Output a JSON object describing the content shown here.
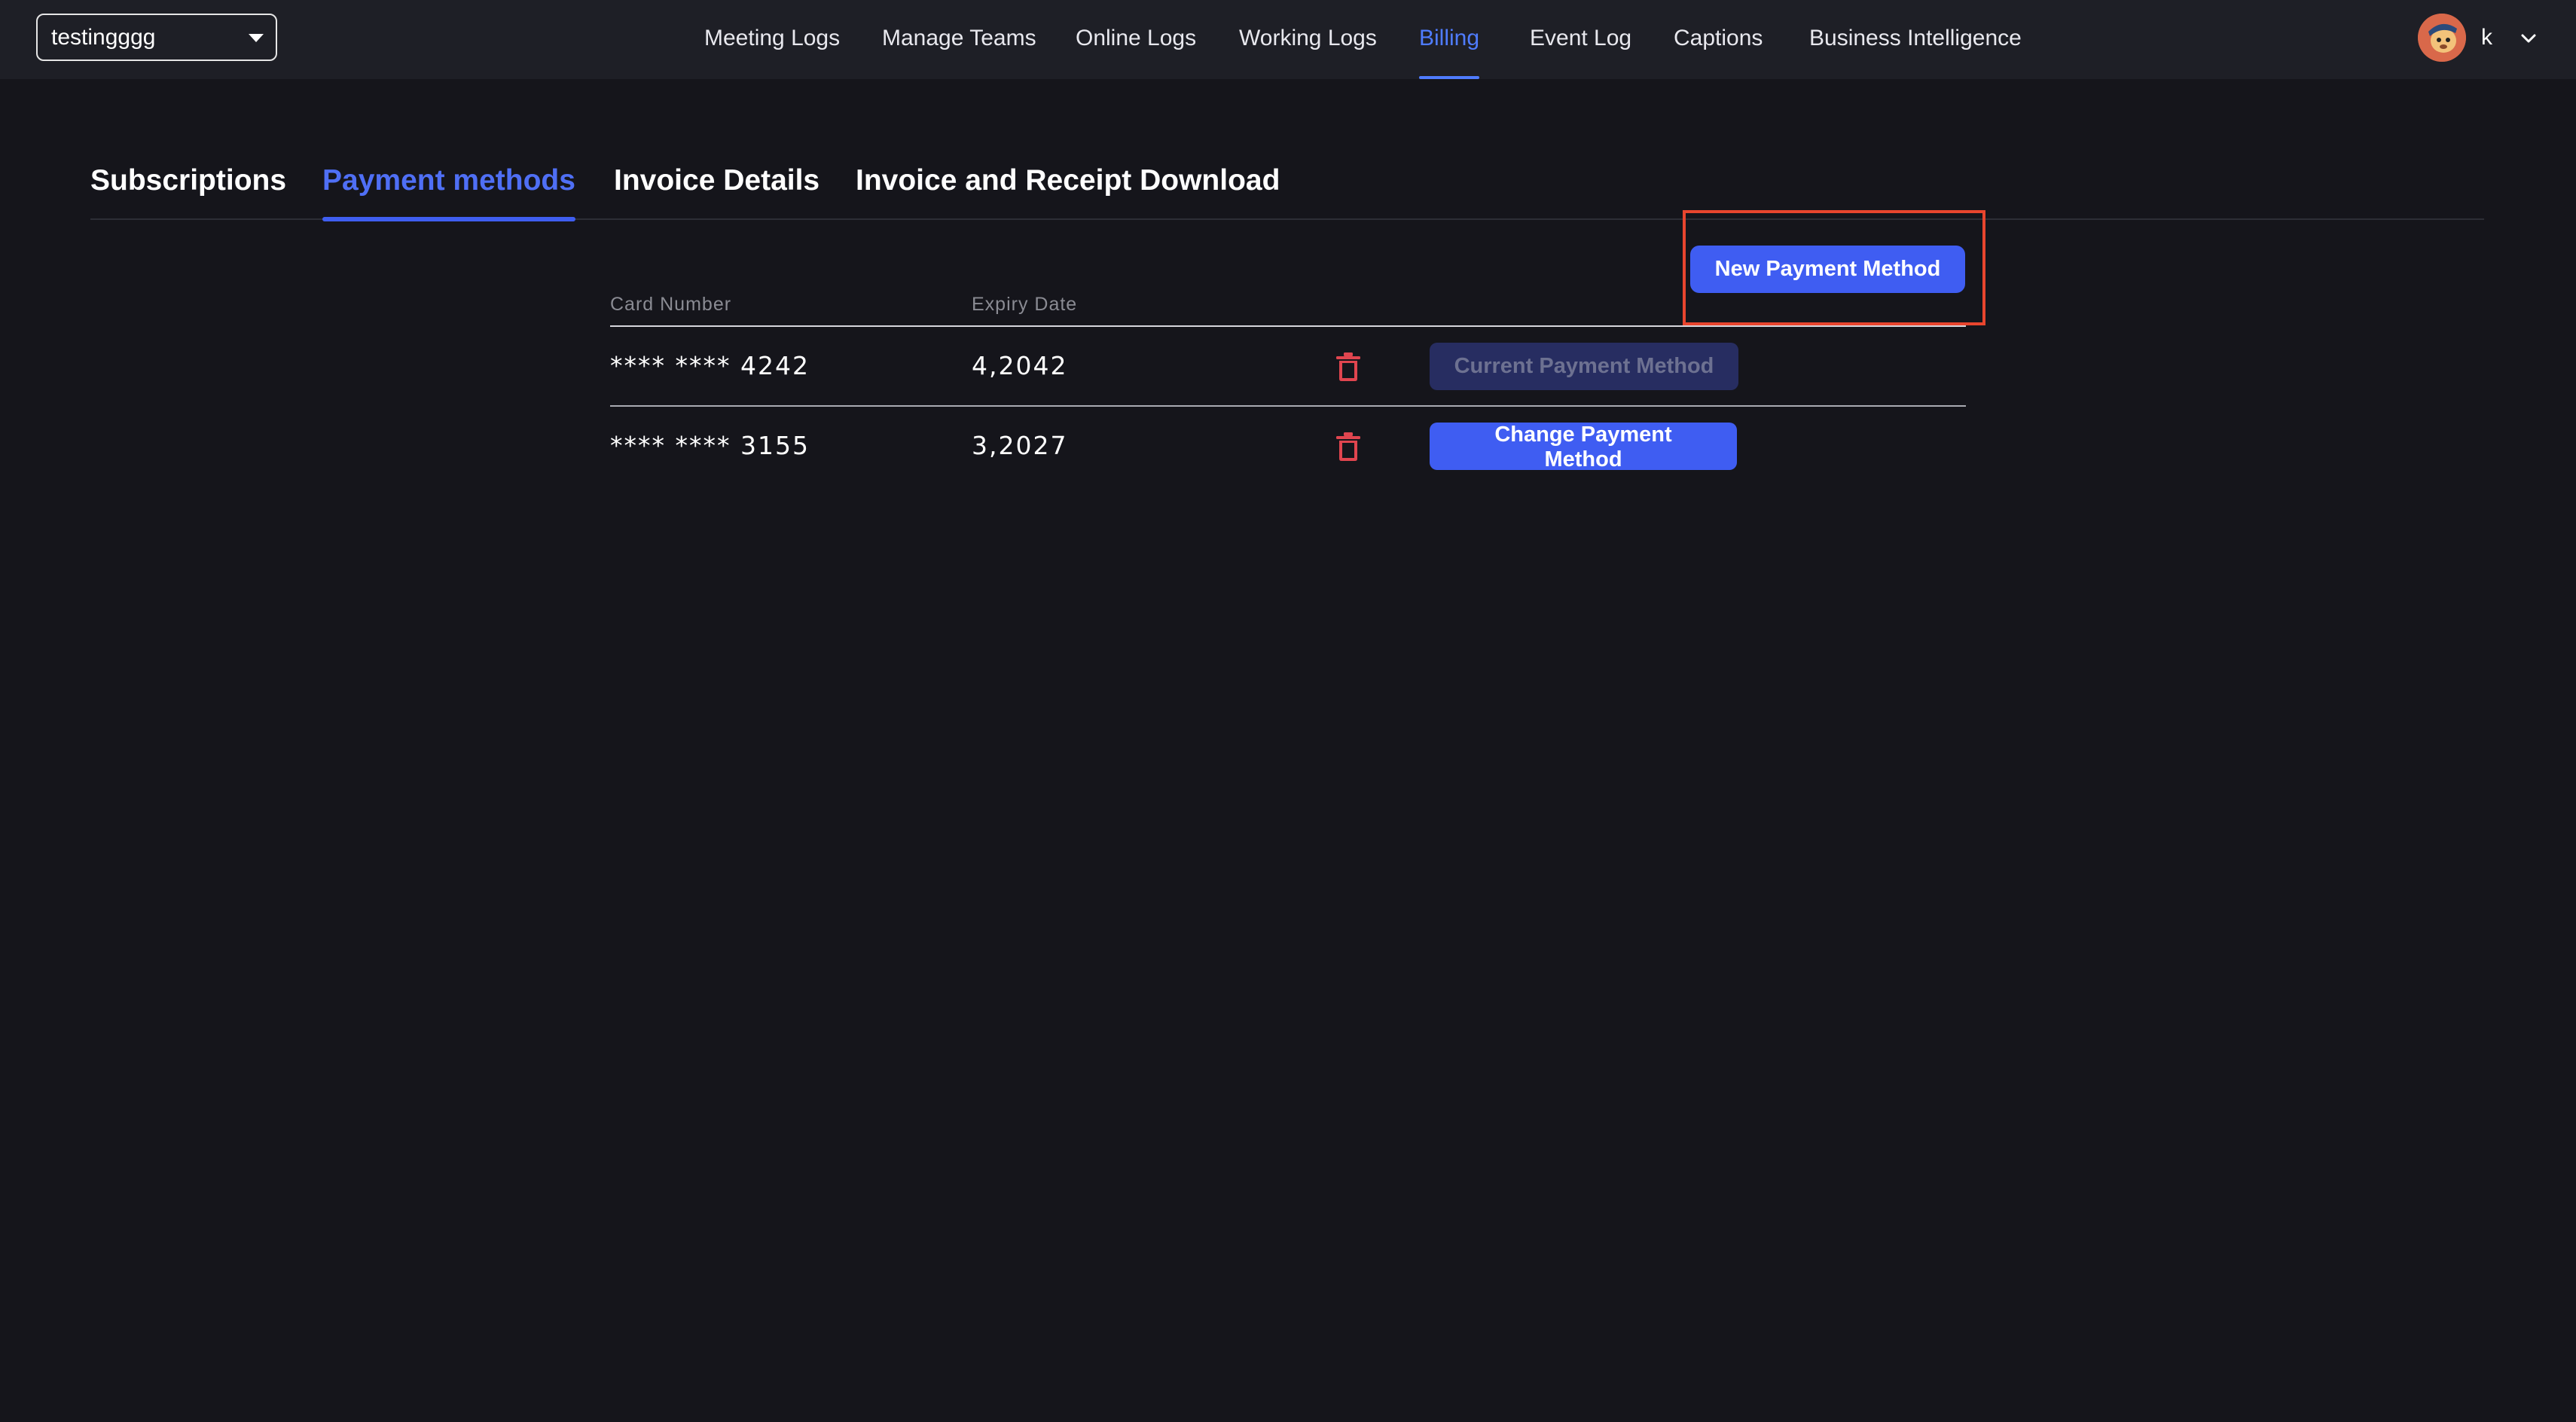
{
  "workspace": {
    "selected": "testingggg"
  },
  "nav": {
    "items": [
      {
        "label": "Meeting Logs",
        "active": false
      },
      {
        "label": "Manage Teams",
        "active": false
      },
      {
        "label": "Online Logs",
        "active": false
      },
      {
        "label": "Working Logs",
        "active": false
      },
      {
        "label": "Billing",
        "active": true
      },
      {
        "label": "Event Log",
        "active": false
      },
      {
        "label": "Captions",
        "active": false
      },
      {
        "label": "Business Intelligence",
        "active": false
      }
    ],
    "accent_color": "#4f7cff"
  },
  "user": {
    "name": "k",
    "avatar_icon": "avatar-icon",
    "menu_icon": "chevron-down-icon"
  },
  "tabs": [
    {
      "label": "Subscriptions",
      "active": false
    },
    {
      "label": "Payment methods",
      "active": true
    },
    {
      "label": "Invoice Details",
      "active": false
    },
    {
      "label": "Invoice and Receipt Download",
      "active": false
    }
  ],
  "payment_methods": {
    "new_button_label": "New Payment Method",
    "columns": {
      "card_number": "Card Number",
      "expiry_date": "Expiry Date"
    },
    "rows": [
      {
        "card_number": "**** **** 4242",
        "expiry": "4,2042",
        "delete_icon": "trash-icon",
        "action_label": "Current Payment Method",
        "is_current": true
      },
      {
        "card_number": "**** **** 3155",
        "expiry": "3,2027",
        "delete_icon": "trash-icon",
        "action_label": "Change Payment Method",
        "is_current": false
      }
    ]
  },
  "colors": {
    "background": "#15151b",
    "topbar": "#1e1f26",
    "primary_button": "#3f5df2",
    "disabled_button": "#272d61",
    "delete_icon": "#e0454f",
    "highlight_box": "#e8452e"
  }
}
